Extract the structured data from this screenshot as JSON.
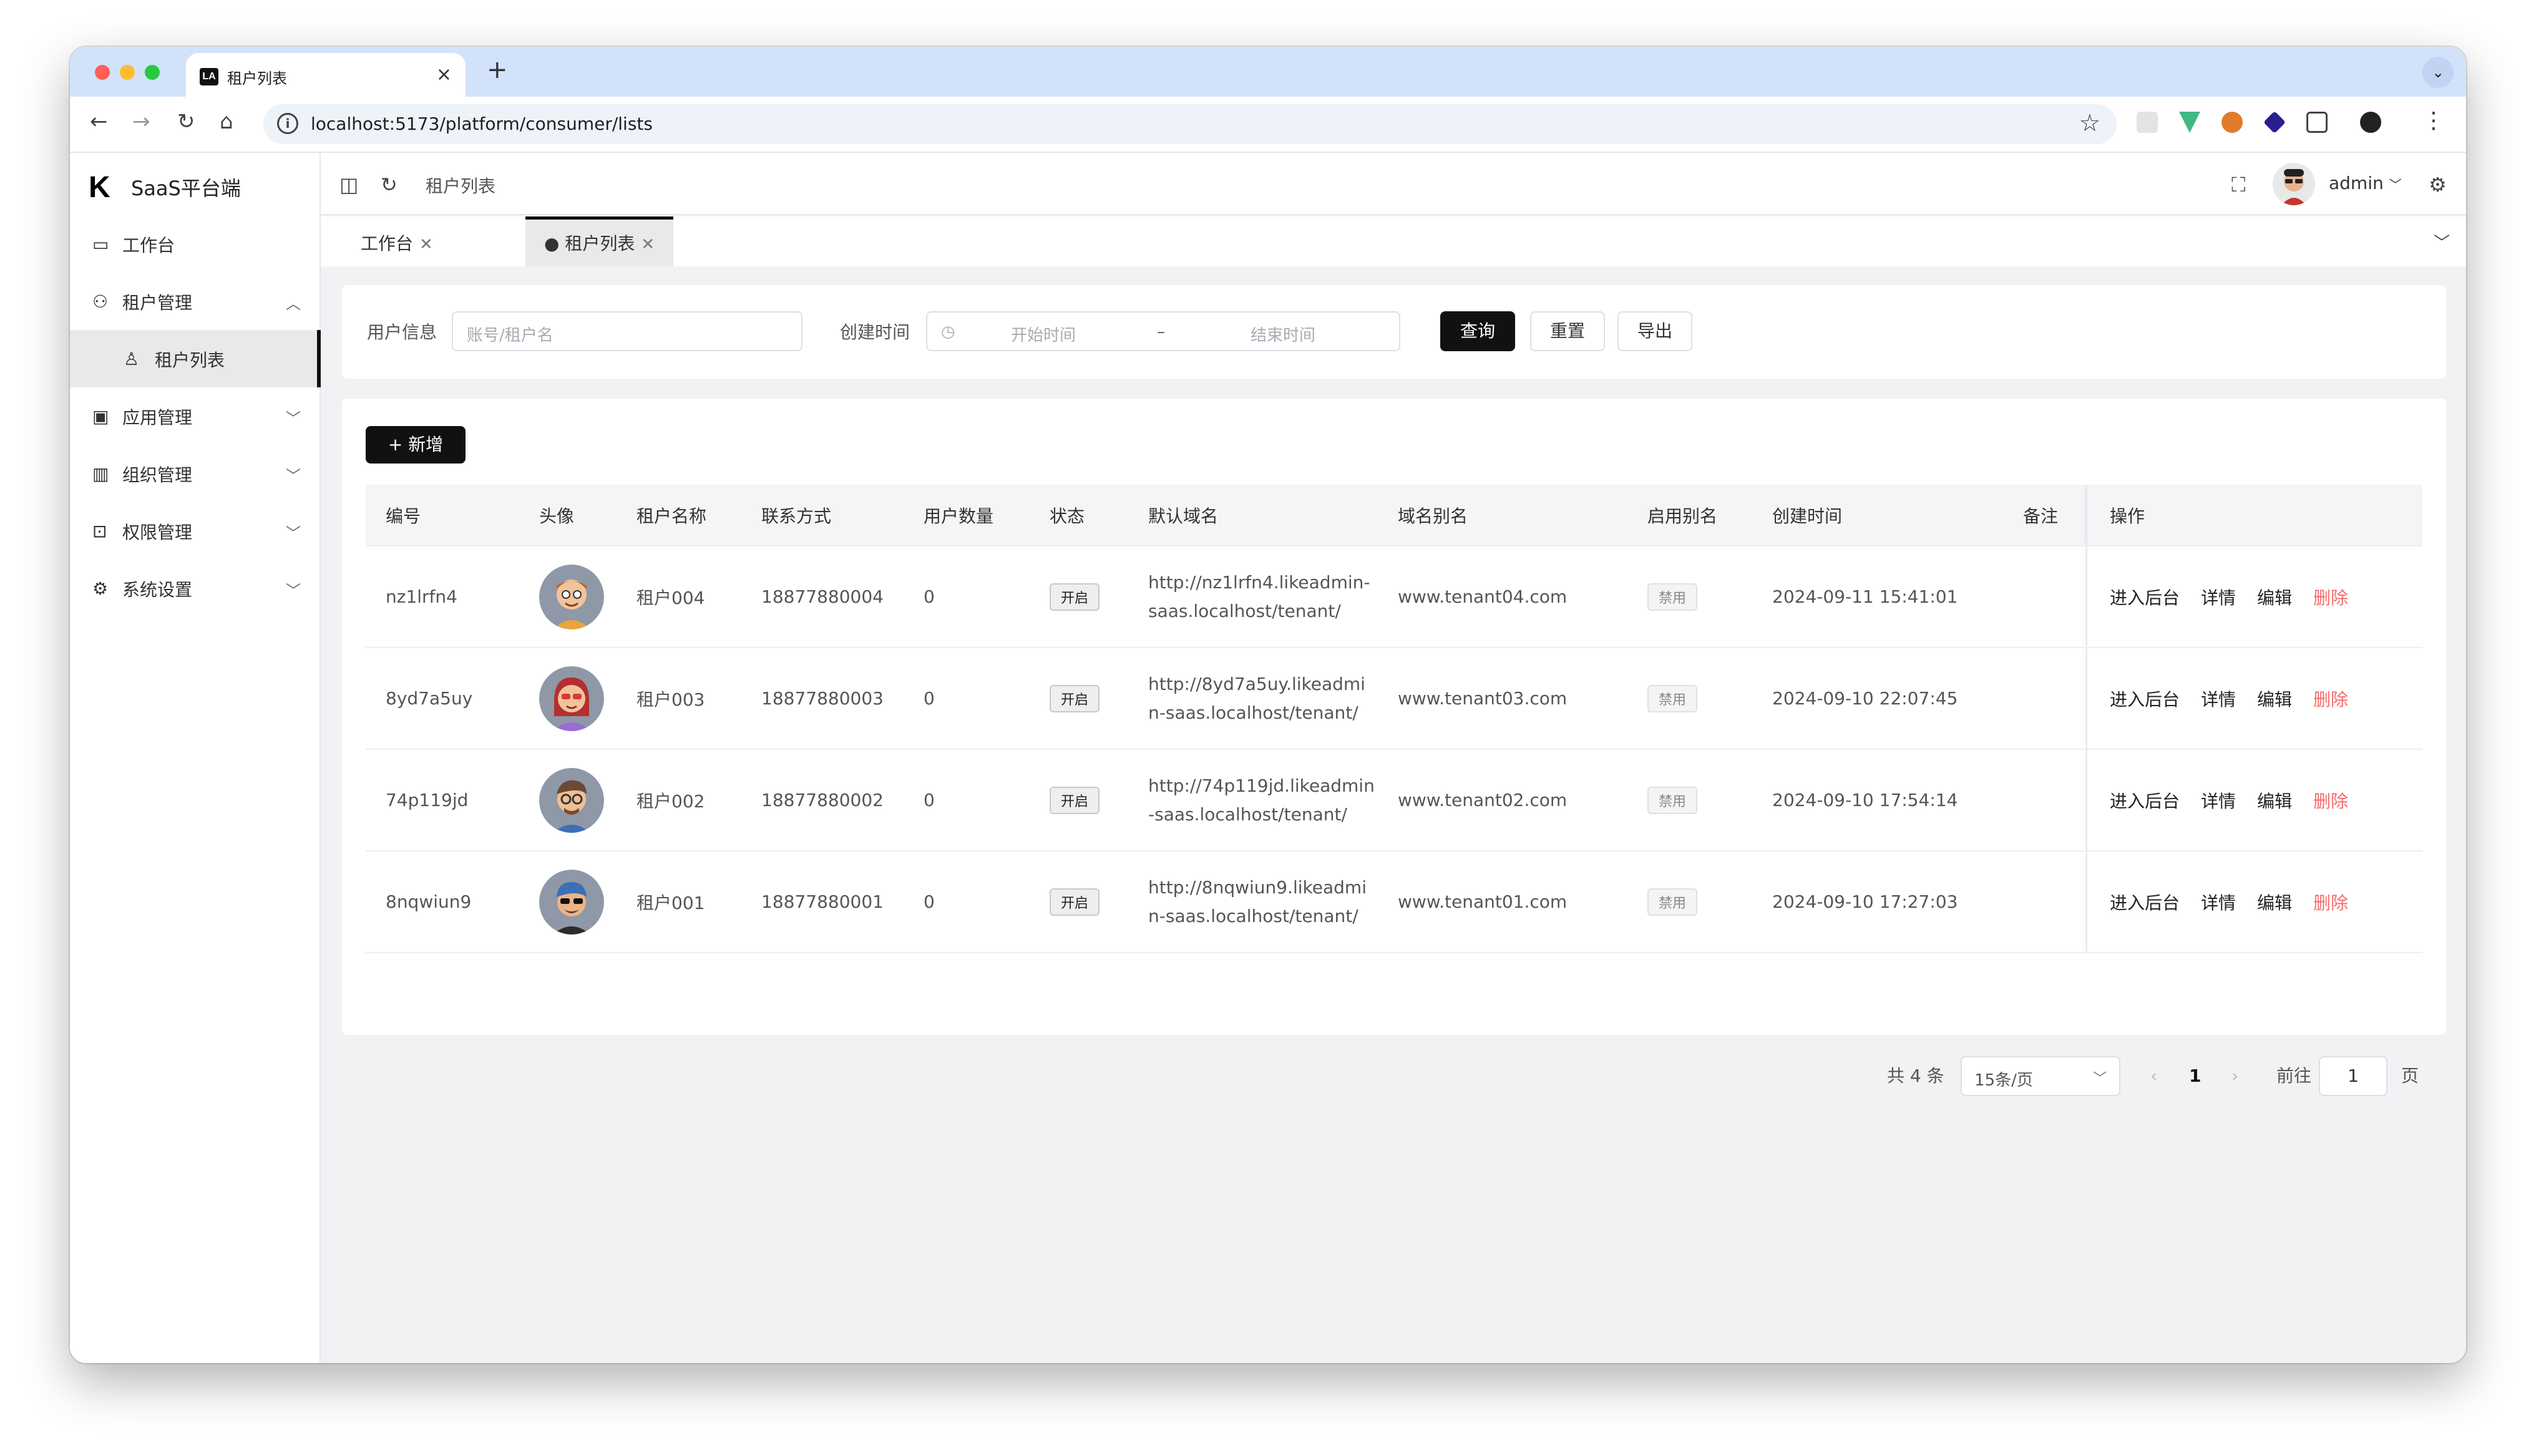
{
  "browser": {
    "tab_title": "租户列表",
    "tab_favicon": "LA",
    "url": "localhost:5173/platform/consumer/lists"
  },
  "sidebar": {
    "brand": "SaaS平台端",
    "items": [
      {
        "label": "工作台",
        "icon": "monitor-icon"
      },
      {
        "label": "租户管理",
        "icon": "users-icon",
        "expanded": true
      },
      {
        "label": "租户列表",
        "icon": "user-icon",
        "active": true
      },
      {
        "label": "应用管理",
        "icon": "app-icon"
      },
      {
        "label": "组织管理",
        "icon": "org-icon"
      },
      {
        "label": "权限管理",
        "icon": "lock-icon"
      },
      {
        "label": "系统设置",
        "icon": "gear-icon"
      }
    ]
  },
  "header": {
    "breadcrumb": "租户列表",
    "user": "admin"
  },
  "tabs": [
    {
      "label": "工作台",
      "active": false
    },
    {
      "label": "● 租户列表",
      "active": true
    }
  ],
  "filter": {
    "user_label": "用户信息",
    "user_placeholder": "账号/租户名",
    "time_label": "创建时间",
    "start_placeholder": "开始时间",
    "range_sep": "–",
    "end_placeholder": "结束时间",
    "query": "查询",
    "reset": "重置",
    "export": "导出"
  },
  "add_button": "+ 新增",
  "table": {
    "columns": [
      "编号",
      "头像",
      "租户名称",
      "联系方式",
      "用户数量",
      "状态",
      "默认域名",
      "域名别名",
      "启用别名",
      "创建时间",
      "备注",
      "操作"
    ],
    "rows": [
      {
        "id": "nz1lrfn4",
        "name": "租户004",
        "phone": "18877880004",
        "users": "0",
        "status": "开启",
        "domain_line1": "http://nz1lrfn4.likeadmin-",
        "domain_line2": "saas.localhost/tenant/",
        "alias": "www.tenant04.com",
        "alias_enabled": "禁用",
        "created": "2024-09-11 15:41:01",
        "remark": ""
      },
      {
        "id": "8yd7a5uy",
        "name": "租户003",
        "phone": "18877880003",
        "users": "0",
        "status": "开启",
        "domain_line1": "http://8yd7a5uy.likeadmi",
        "domain_line2": "n-saas.localhost/tenant/",
        "alias": "www.tenant03.com",
        "alias_enabled": "禁用",
        "created": "2024-09-10 22:07:45",
        "remark": ""
      },
      {
        "id": "74p119jd",
        "name": "租户002",
        "phone": "18877880002",
        "users": "0",
        "status": "开启",
        "domain_line1": "http://74p119jd.likeadmin",
        "domain_line2": "-saas.localhost/tenant/",
        "alias": "www.tenant02.com",
        "alias_enabled": "禁用",
        "created": "2024-09-10 17:54:14",
        "remark": ""
      },
      {
        "id": "8nqwiun9",
        "name": "租户001",
        "phone": "18877880001",
        "users": "0",
        "status": "开启",
        "domain_line1": "http://8nqwiun9.likeadmi",
        "domain_line2": "n-saas.localhost/tenant/",
        "alias": "www.tenant01.com",
        "alias_enabled": "禁用",
        "created": "2024-09-10 17:27:03",
        "remark": ""
      }
    ],
    "actions": [
      "进入后台",
      "详情",
      "编辑",
      "删除"
    ]
  },
  "pagination": {
    "total": "共 4 条",
    "page_size": "15条/页",
    "current": "1",
    "goto_label": "前往",
    "goto_value": "1",
    "page_suffix": "页"
  },
  "colors": {
    "primary": "#111111",
    "danger": "#f56c6c",
    "tab_bar": "#d3e2fb"
  }
}
